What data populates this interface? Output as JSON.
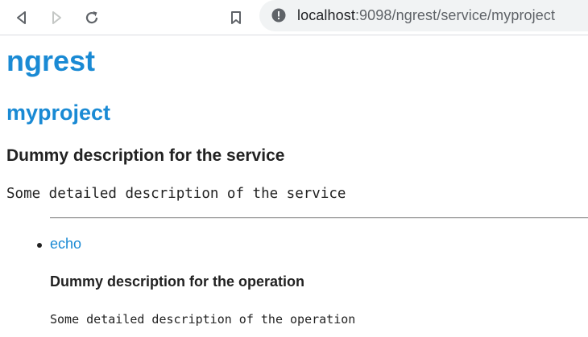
{
  "browser": {
    "url_host": "localhost",
    "url_rest": ":9098/ngrest/service/myproject",
    "back_icon": "back-arrow-icon",
    "forward_icon": "forward-arrow-icon",
    "reload_icon": "reload-icon",
    "bookmark_icon": "bookmark-icon",
    "site_info_icon": "info-icon"
  },
  "page": {
    "app_title": "ngrest",
    "service_name": "myproject",
    "service_summary": "Dummy description for the service",
    "service_description": "Some detailed description of the service",
    "operations": [
      {
        "name": "echo",
        "summary": "Dummy description for the operation",
        "description": "Some detailed description of the operation"
      }
    ]
  },
  "colors": {
    "heading_blue": "#1a8ad4",
    "text": "#222222",
    "omnibox_bg": "#f1f3f4"
  }
}
